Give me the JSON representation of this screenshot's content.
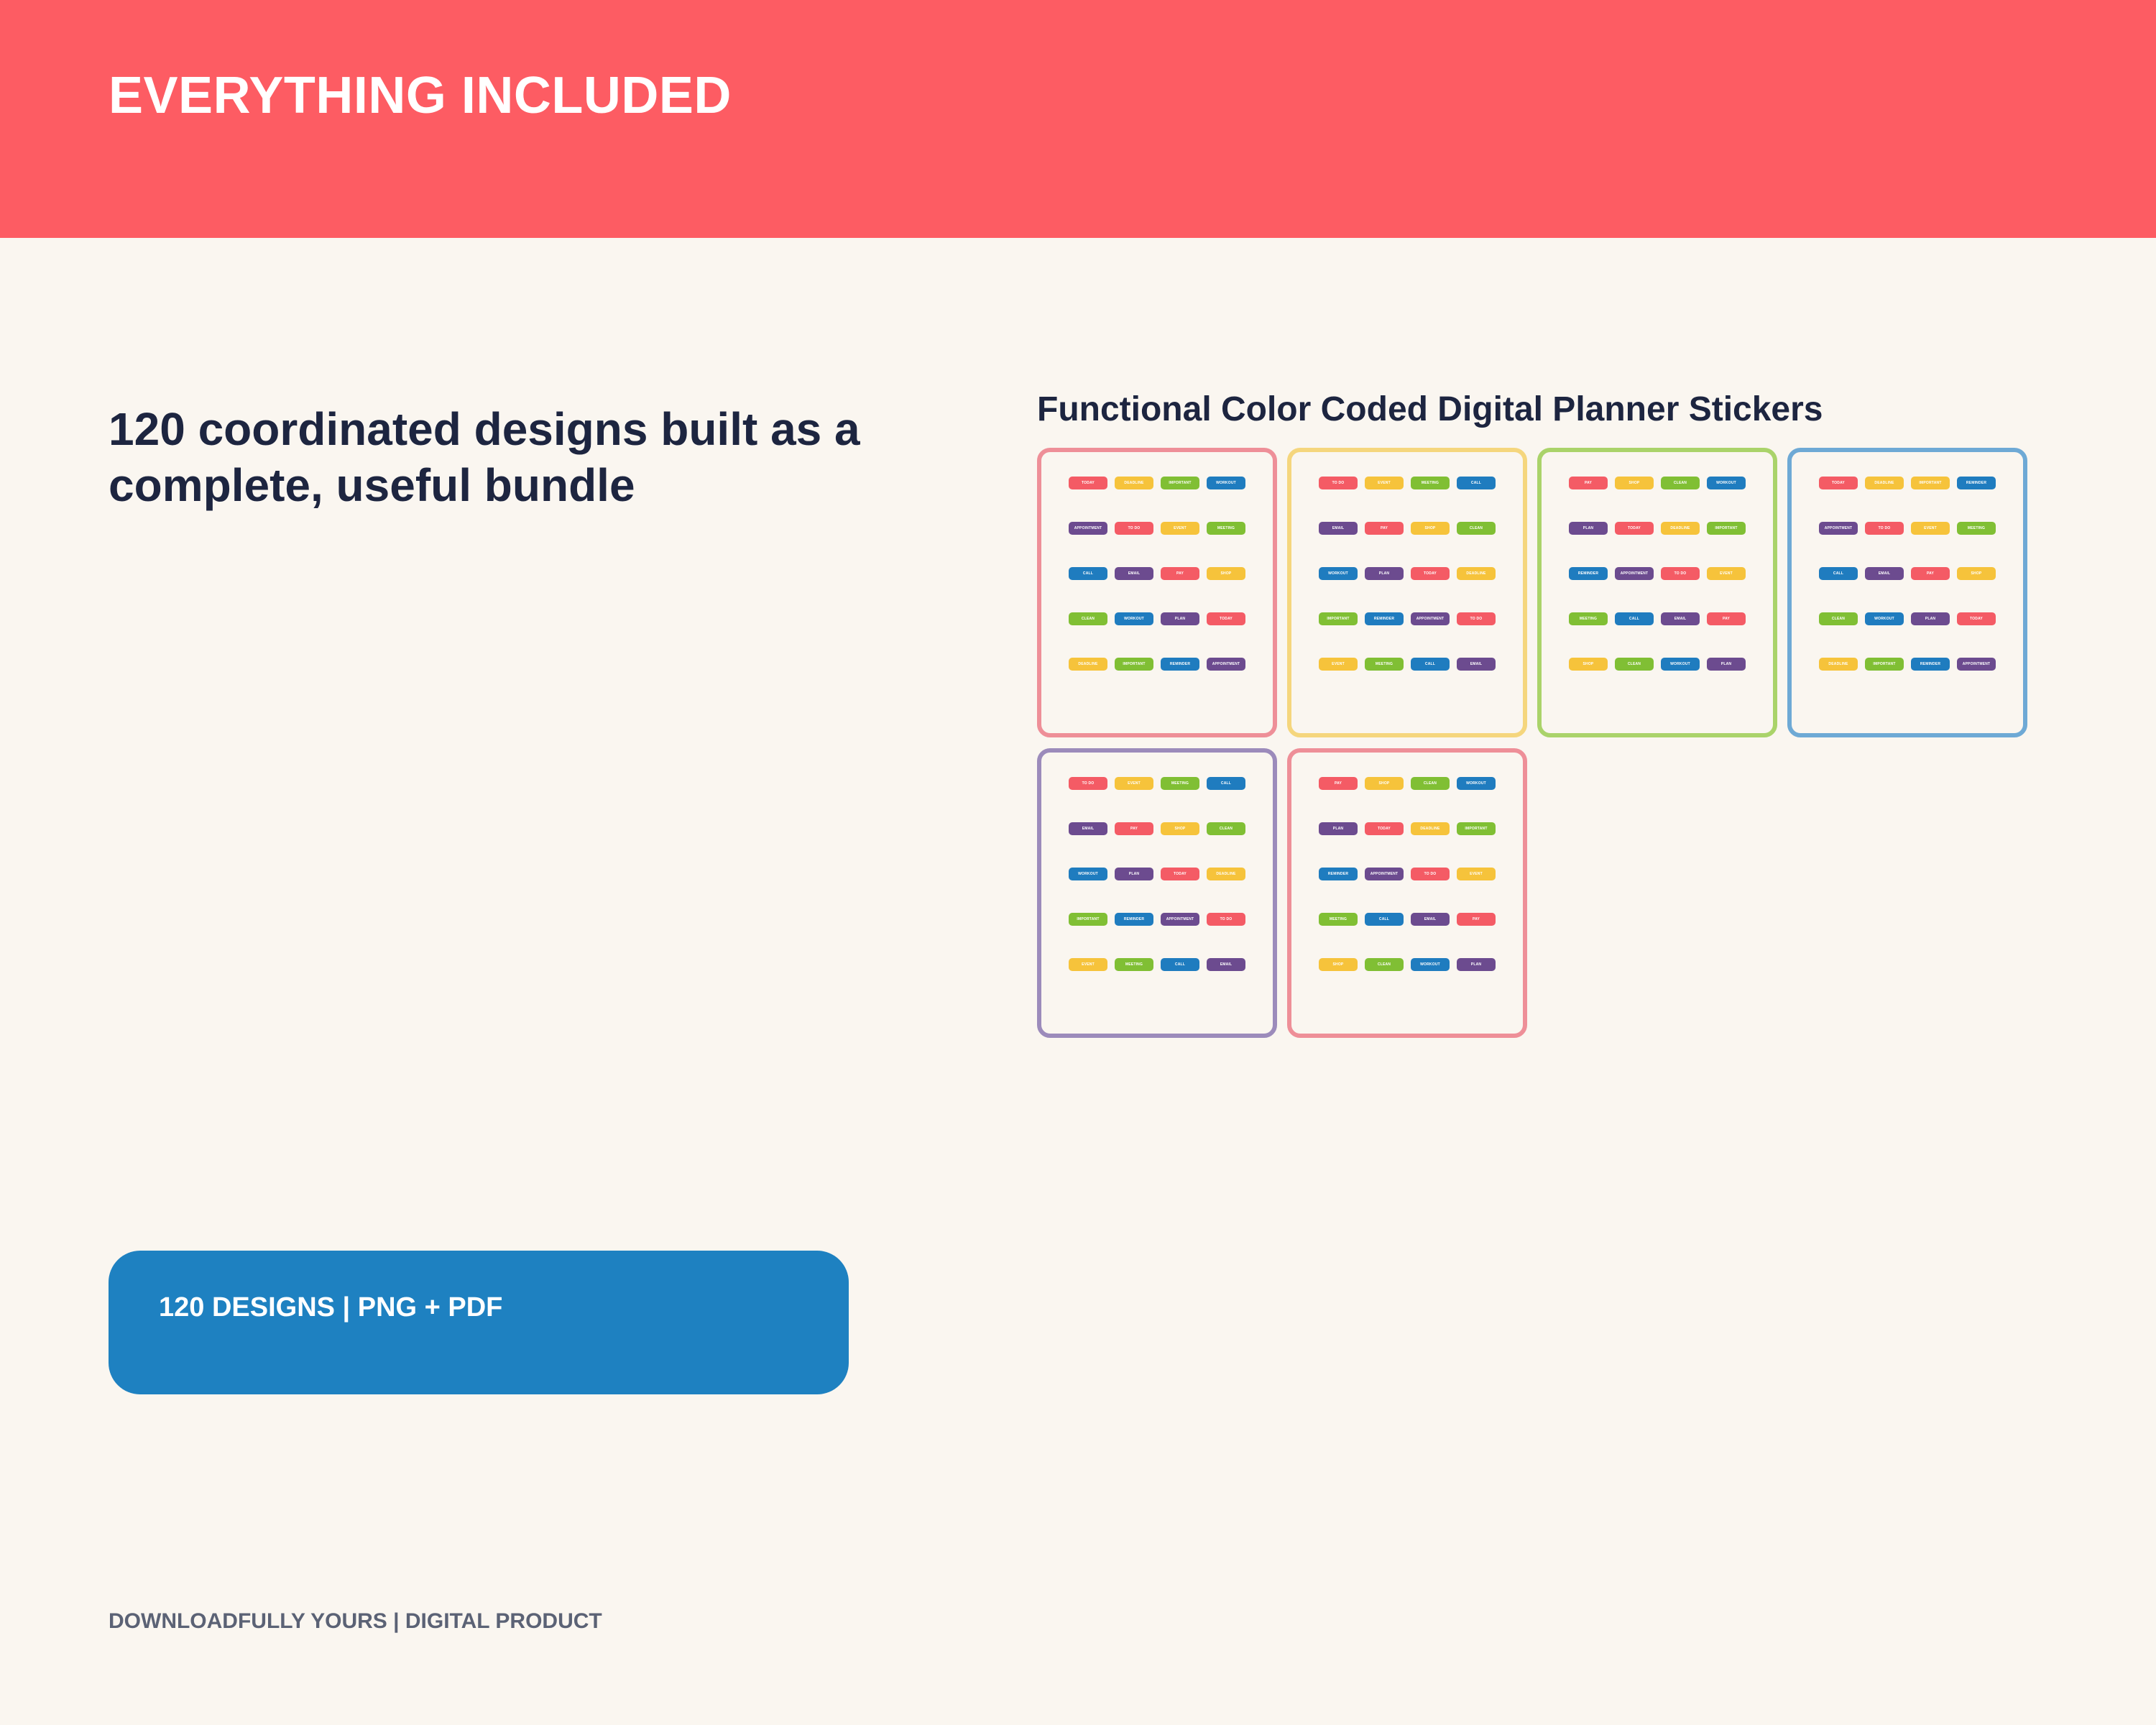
{
  "header": {
    "title": "EVERYTHING INCLUDED"
  },
  "headline": "120 coordinated designs built as a complete, useful bundle",
  "badge": {
    "label": "120 DESIGNS | PNG + PDF"
  },
  "footer": {
    "text": "DOWNLOADFULLY YOURS | DIGITAL PRODUCT"
  },
  "showcase": {
    "title": "Functional Color Coded Digital Planner Stickers",
    "colors": {
      "red": "#f45b65",
      "yellow": "#f6c33b",
      "green": "#80bf34",
      "blue": "#1f7cbf",
      "purple": "#6c4b8f"
    },
    "sheets": [
      {
        "border": "#ee8f98",
        "stickers": [
          [
            "red",
            "TODAY"
          ],
          [
            "yellow",
            "DEADLINE"
          ],
          [
            "green",
            "IMPORTANT"
          ],
          [
            "blue",
            "WORKOUT"
          ],
          [
            "purple",
            "APPOINTMENT"
          ],
          [
            "red",
            "TO DO"
          ],
          [
            "yellow",
            "EVENT"
          ],
          [
            "green",
            "MEETING"
          ],
          [
            "blue",
            "CALL"
          ],
          [
            "purple",
            "EMAIL"
          ],
          [
            "red",
            "PAY"
          ],
          [
            "yellow",
            "SHOP"
          ],
          [
            "green",
            "CLEAN"
          ],
          [
            "blue",
            "WORKOUT"
          ],
          [
            "purple",
            "PLAN"
          ],
          [
            "red",
            "TODAY"
          ],
          [
            "yellow",
            "DEADLINE"
          ],
          [
            "green",
            "IMPORTANT"
          ],
          [
            "blue",
            "REMINDER"
          ],
          [
            "purple",
            "APPOINTMENT"
          ]
        ]
      },
      {
        "border": "#f5d67d",
        "stickers": [
          [
            "red",
            "TO DO"
          ],
          [
            "yellow",
            "EVENT"
          ],
          [
            "green",
            "MEETING"
          ],
          [
            "blue",
            "CALL"
          ],
          [
            "purple",
            "EMAIL"
          ],
          [
            "red",
            "PAY"
          ],
          [
            "yellow",
            "SHOP"
          ],
          [
            "green",
            "CLEAN"
          ],
          [
            "blue",
            "WORKOUT"
          ],
          [
            "purple",
            "PLAN"
          ],
          [
            "red",
            "TODAY"
          ],
          [
            "yellow",
            "DEADLINE"
          ],
          [
            "green",
            "IMPORTANT"
          ],
          [
            "blue",
            "REMINDER"
          ],
          [
            "purple",
            "APPOINTMENT"
          ],
          [
            "red",
            "TO DO"
          ],
          [
            "yellow",
            "EVENT"
          ],
          [
            "green",
            "MEETING"
          ],
          [
            "blue",
            "CALL"
          ],
          [
            "purple",
            "EMAIL"
          ]
        ]
      },
      {
        "border": "#aad36a",
        "stickers": [
          [
            "red",
            "PAY"
          ],
          [
            "yellow",
            "SHOP"
          ],
          [
            "green",
            "CLEAN"
          ],
          [
            "blue",
            "WORKOUT"
          ],
          [
            "purple",
            "PLAN"
          ],
          [
            "red",
            "TODAY"
          ],
          [
            "yellow",
            "DEADLINE"
          ],
          [
            "green",
            "IMPORTANT"
          ],
          [
            "blue",
            "REMINDER"
          ],
          [
            "purple",
            "APPOINTMENT"
          ],
          [
            "red",
            "TO DO"
          ],
          [
            "yellow",
            "EVENT"
          ],
          [
            "green",
            "MEETING"
          ],
          [
            "blue",
            "CALL"
          ],
          [
            "purple",
            "EMAIL"
          ],
          [
            "red",
            "PAY"
          ],
          [
            "yellow",
            "SHOP"
          ],
          [
            "green",
            "CLEAN"
          ],
          [
            "blue",
            "WORKOUT"
          ],
          [
            "purple",
            "PLAN"
          ]
        ]
      },
      {
        "border": "#6ea9d5",
        "stickers": [
          [
            "red",
            "TODAY"
          ],
          [
            "yellow",
            "DEADLINE"
          ],
          [
            "yellow",
            "IMPORTANT"
          ],
          [
            "blue",
            "REMINDER"
          ],
          [
            "purple",
            "APPOINTMENT"
          ],
          [
            "red",
            "TO DO"
          ],
          [
            "yellow",
            "EVENT"
          ],
          [
            "green",
            "MEETING"
          ],
          [
            "blue",
            "CALL"
          ],
          [
            "purple",
            "EMAIL"
          ],
          [
            "red",
            "PAY"
          ],
          [
            "yellow",
            "SHOP"
          ],
          [
            "green",
            "CLEAN"
          ],
          [
            "blue",
            "WORKOUT"
          ],
          [
            "purple",
            "PLAN"
          ],
          [
            "red",
            "TODAY"
          ],
          [
            "yellow",
            "DEADLINE"
          ],
          [
            "green",
            "IMPORTANT"
          ],
          [
            "blue",
            "REMINDER"
          ],
          [
            "purple",
            "APPOINTMENT"
          ]
        ]
      },
      {
        "border": "#9c8bbb",
        "stickers": [
          [
            "red",
            "TO DO"
          ],
          [
            "yellow",
            "EVENT"
          ],
          [
            "green",
            "MEETING"
          ],
          [
            "blue",
            "CALL"
          ],
          [
            "purple",
            "EMAIL"
          ],
          [
            "red",
            "PAY"
          ],
          [
            "yellow",
            "SHOP"
          ],
          [
            "green",
            "CLEAN"
          ],
          [
            "blue",
            "WORKOUT"
          ],
          [
            "purple",
            "PLAN"
          ],
          [
            "red",
            "TODAY"
          ],
          [
            "yellow",
            "DEADLINE"
          ],
          [
            "green",
            "IMPORTANT"
          ],
          [
            "blue",
            "REMINDER"
          ],
          [
            "purple",
            "APPOINTMENT"
          ],
          [
            "red",
            "TO DO"
          ],
          [
            "yellow",
            "EVENT"
          ],
          [
            "green",
            "MEETING"
          ],
          [
            "blue",
            "CALL"
          ],
          [
            "purple",
            "EMAIL"
          ]
        ]
      },
      {
        "border": "#ee8f98",
        "stickers": [
          [
            "red",
            "PAY"
          ],
          [
            "yellow",
            "SHOP"
          ],
          [
            "green",
            "CLEAN"
          ],
          [
            "blue",
            "WORKOUT"
          ],
          [
            "purple",
            "PLAN"
          ],
          [
            "red",
            "TODAY"
          ],
          [
            "yellow",
            "DEADLINE"
          ],
          [
            "green",
            "IMPORTANT"
          ],
          [
            "blue",
            "REMINDER"
          ],
          [
            "purple",
            "APPOINTMENT"
          ],
          [
            "red",
            "TO DO"
          ],
          [
            "yellow",
            "EVENT"
          ],
          [
            "green",
            "MEETING"
          ],
          [
            "blue",
            "CALL"
          ],
          [
            "purple",
            "EMAIL"
          ],
          [
            "red",
            "PAY"
          ],
          [
            "yellow",
            "SHOP"
          ],
          [
            "green",
            "CLEAN"
          ],
          [
            "blue",
            "WORKOUT"
          ],
          [
            "purple",
            "PLAN"
          ]
        ]
      }
    ]
  }
}
